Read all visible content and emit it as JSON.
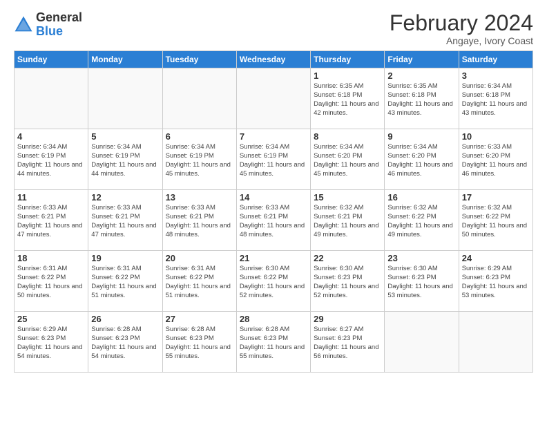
{
  "logo": {
    "general": "General",
    "blue": "Blue"
  },
  "header": {
    "month": "February 2024",
    "location": "Angaye, Ivory Coast"
  },
  "days_of_week": [
    "Sunday",
    "Monday",
    "Tuesday",
    "Wednesday",
    "Thursday",
    "Friday",
    "Saturday"
  ],
  "weeks": [
    [
      {
        "day": "",
        "info": ""
      },
      {
        "day": "",
        "info": ""
      },
      {
        "day": "",
        "info": ""
      },
      {
        "day": "",
        "info": ""
      },
      {
        "day": "1",
        "info": "Sunrise: 6:35 AM\nSunset: 6:18 PM\nDaylight: 11 hours and 42 minutes."
      },
      {
        "day": "2",
        "info": "Sunrise: 6:35 AM\nSunset: 6:18 PM\nDaylight: 11 hours and 43 minutes."
      },
      {
        "day": "3",
        "info": "Sunrise: 6:34 AM\nSunset: 6:18 PM\nDaylight: 11 hours and 43 minutes."
      }
    ],
    [
      {
        "day": "4",
        "info": "Sunrise: 6:34 AM\nSunset: 6:19 PM\nDaylight: 11 hours and 44 minutes."
      },
      {
        "day": "5",
        "info": "Sunrise: 6:34 AM\nSunset: 6:19 PM\nDaylight: 11 hours and 44 minutes."
      },
      {
        "day": "6",
        "info": "Sunrise: 6:34 AM\nSunset: 6:19 PM\nDaylight: 11 hours and 45 minutes."
      },
      {
        "day": "7",
        "info": "Sunrise: 6:34 AM\nSunset: 6:19 PM\nDaylight: 11 hours and 45 minutes."
      },
      {
        "day": "8",
        "info": "Sunrise: 6:34 AM\nSunset: 6:20 PM\nDaylight: 11 hours and 45 minutes."
      },
      {
        "day": "9",
        "info": "Sunrise: 6:34 AM\nSunset: 6:20 PM\nDaylight: 11 hours and 46 minutes."
      },
      {
        "day": "10",
        "info": "Sunrise: 6:33 AM\nSunset: 6:20 PM\nDaylight: 11 hours and 46 minutes."
      }
    ],
    [
      {
        "day": "11",
        "info": "Sunrise: 6:33 AM\nSunset: 6:21 PM\nDaylight: 11 hours and 47 minutes."
      },
      {
        "day": "12",
        "info": "Sunrise: 6:33 AM\nSunset: 6:21 PM\nDaylight: 11 hours and 47 minutes."
      },
      {
        "day": "13",
        "info": "Sunrise: 6:33 AM\nSunset: 6:21 PM\nDaylight: 11 hours and 48 minutes."
      },
      {
        "day": "14",
        "info": "Sunrise: 6:33 AM\nSunset: 6:21 PM\nDaylight: 11 hours and 48 minutes."
      },
      {
        "day": "15",
        "info": "Sunrise: 6:32 AM\nSunset: 6:21 PM\nDaylight: 11 hours and 49 minutes."
      },
      {
        "day": "16",
        "info": "Sunrise: 6:32 AM\nSunset: 6:22 PM\nDaylight: 11 hours and 49 minutes."
      },
      {
        "day": "17",
        "info": "Sunrise: 6:32 AM\nSunset: 6:22 PM\nDaylight: 11 hours and 50 minutes."
      }
    ],
    [
      {
        "day": "18",
        "info": "Sunrise: 6:31 AM\nSunset: 6:22 PM\nDaylight: 11 hours and 50 minutes."
      },
      {
        "day": "19",
        "info": "Sunrise: 6:31 AM\nSunset: 6:22 PM\nDaylight: 11 hours and 51 minutes."
      },
      {
        "day": "20",
        "info": "Sunrise: 6:31 AM\nSunset: 6:22 PM\nDaylight: 11 hours and 51 minutes."
      },
      {
        "day": "21",
        "info": "Sunrise: 6:30 AM\nSunset: 6:22 PM\nDaylight: 11 hours and 52 minutes."
      },
      {
        "day": "22",
        "info": "Sunrise: 6:30 AM\nSunset: 6:23 PM\nDaylight: 11 hours and 52 minutes."
      },
      {
        "day": "23",
        "info": "Sunrise: 6:30 AM\nSunset: 6:23 PM\nDaylight: 11 hours and 53 minutes."
      },
      {
        "day": "24",
        "info": "Sunrise: 6:29 AM\nSunset: 6:23 PM\nDaylight: 11 hours and 53 minutes."
      }
    ],
    [
      {
        "day": "25",
        "info": "Sunrise: 6:29 AM\nSunset: 6:23 PM\nDaylight: 11 hours and 54 minutes."
      },
      {
        "day": "26",
        "info": "Sunrise: 6:28 AM\nSunset: 6:23 PM\nDaylight: 11 hours and 54 minutes."
      },
      {
        "day": "27",
        "info": "Sunrise: 6:28 AM\nSunset: 6:23 PM\nDaylight: 11 hours and 55 minutes."
      },
      {
        "day": "28",
        "info": "Sunrise: 6:28 AM\nSunset: 6:23 PM\nDaylight: 11 hours and 55 minutes."
      },
      {
        "day": "29",
        "info": "Sunrise: 6:27 AM\nSunset: 6:23 PM\nDaylight: 11 hours and 56 minutes."
      },
      {
        "day": "",
        "info": ""
      },
      {
        "day": "",
        "info": ""
      }
    ]
  ]
}
